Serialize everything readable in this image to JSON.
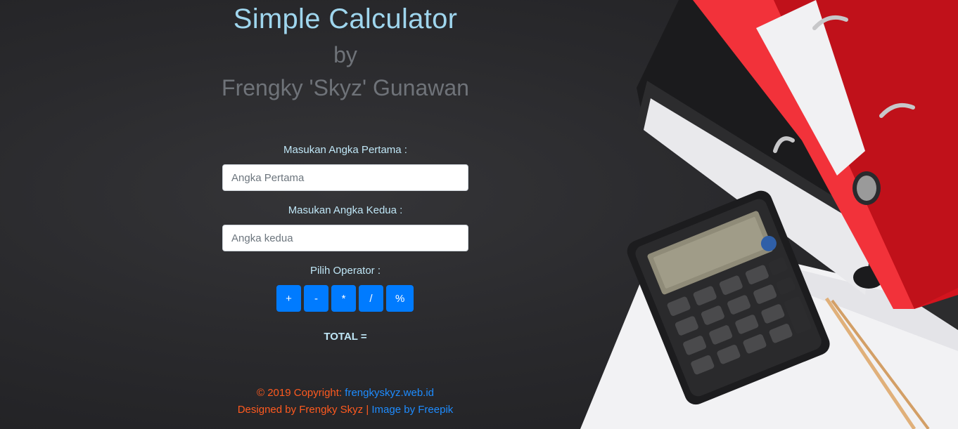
{
  "header": {
    "title": "Simple Calculator",
    "by": "by",
    "author": "Frengky 'Skyz' Gunawan"
  },
  "form": {
    "first_label": "Masukan Angka Pertama :",
    "first_placeholder": "Angka Pertama",
    "first_value": "",
    "second_label": "Masukan Angka Kedua :",
    "second_placeholder": "Angka kedua",
    "second_value": "",
    "operator_label": "Pilih Operator :",
    "operators": [
      "+",
      "-",
      "*",
      "/",
      "%"
    ]
  },
  "result": {
    "total_label": "TOTAL =",
    "total_value": ""
  },
  "footer": {
    "copyright_prefix": "© 2019 Copyright: ",
    "site_link": "frengkyskyz.web.id",
    "designed_by": "Designed by Frengky Skyz",
    "separator": "|",
    "image_credit": "Image by Freepik"
  },
  "colors": {
    "title": "#9fd6ee",
    "subtitle": "#6f7379",
    "label": "#bfe6f6",
    "button": "#007bff",
    "footer_text": "#ff5a1f",
    "footer_link": "#1e8cff",
    "background": "#2a2a2d"
  }
}
